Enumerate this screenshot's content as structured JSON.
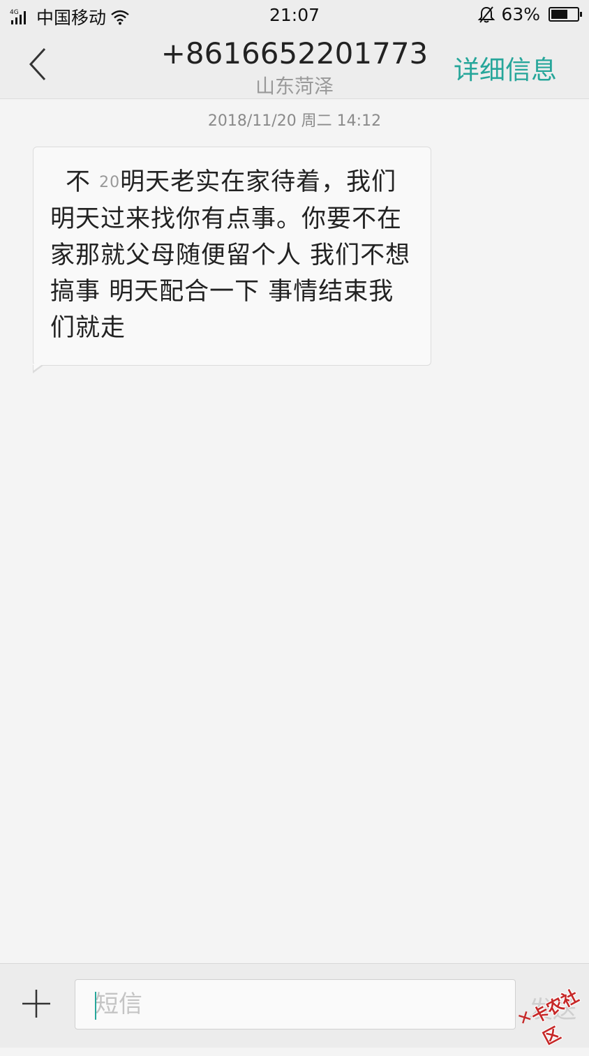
{
  "status_bar": {
    "network": "4G",
    "carrier": "中国移动",
    "time": "21:07",
    "battery": "63%",
    "battery_level": 0.63,
    "icons": [
      "signal-icon",
      "wifi-icon",
      "bell-muted-icon",
      "battery-icon"
    ]
  },
  "header": {
    "title": "+8616652201773",
    "subtitle": "山东菏泽",
    "details_label": "详细信息",
    "accent_color": "#26a69a"
  },
  "conversation": {
    "timestamp": "2018/11/20 周二  14:12",
    "messages": [
      {
        "text_prefix": "不",
        "text_small": "20",
        "text_main": "明天老实在家待着，我们明天过来找你有点事。你要不在家那就父母随便留个人 我们不想搞事 明天配合一下 事情结束我们就走"
      }
    ]
  },
  "composer": {
    "placeholder": "短信",
    "send_label": "发送"
  },
  "watermark": {
    "text": "卡农社区"
  }
}
